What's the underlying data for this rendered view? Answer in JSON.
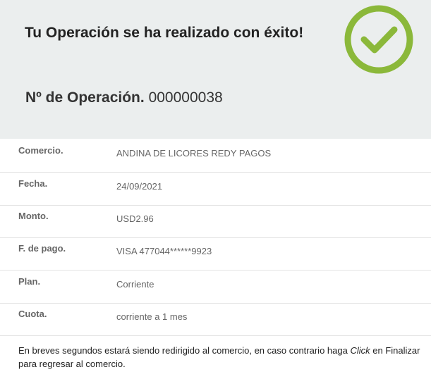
{
  "header": {
    "title": "Tu Operación se ha realizado con éxito!",
    "operation_label": "Nº de Operación.",
    "operation_number": "000000038",
    "check_icon_color": "#8bb83a"
  },
  "details": [
    {
      "label": "Comercio.",
      "value": "ANDINA DE LICORES REDY PAGOS"
    },
    {
      "label": "Fecha.",
      "value": "24/09/2021"
    },
    {
      "label": "Monto.",
      "value": "USD2.96"
    },
    {
      "label": "F. de pago.",
      "value": "VISA 477044******9923"
    },
    {
      "label": "Plan.",
      "value": "Corriente"
    },
    {
      "label": "Cuota.",
      "value": "corriente a 1 mes"
    }
  ],
  "footer": {
    "text_before": "En breves segundos estará siendo redirigido al comercio, en caso contrario haga ",
    "emphasis": "Click",
    "text_after": " en Finalizar para regresar al comercio."
  }
}
